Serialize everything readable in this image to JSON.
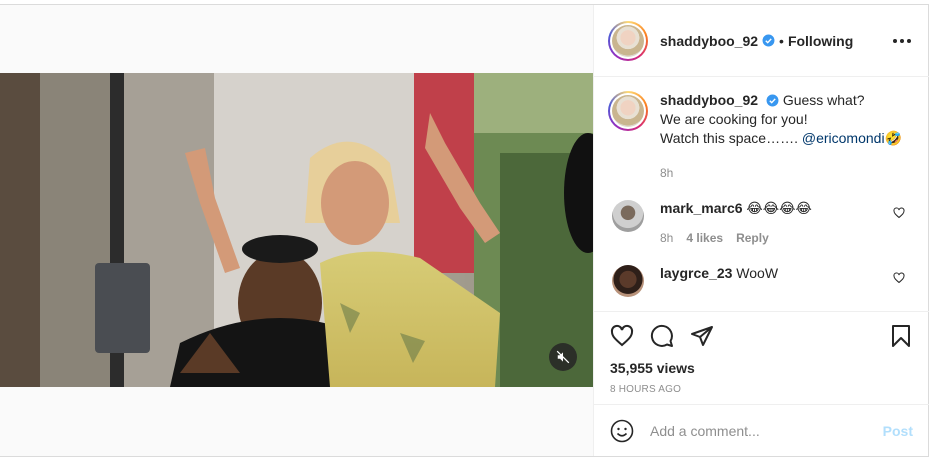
{
  "header": {
    "username": "shaddyboo_92",
    "separator": "•",
    "follow_status": "Following"
  },
  "caption": {
    "username": "shaddyboo_92",
    "line1": "Guess what?",
    "line2": "We are cooking for you!",
    "line3_prefix": "Watch this space…….",
    "mention": "@ericomondi",
    "line3_suffix": "🤣",
    "time": "8h"
  },
  "comments": [
    {
      "username": "mark_marc6",
      "text": "😂😂😂😂",
      "time": "8h",
      "likes": "4 likes",
      "reply": "Reply"
    },
    {
      "username": "laygrce_23",
      "text": "WooW"
    }
  ],
  "stats": {
    "views": "35,955 views",
    "ago": "8 HOURS AGO"
  },
  "composer": {
    "placeholder": "Add a comment...",
    "post_label": "Post"
  },
  "colors": {
    "verified": "#3897f0",
    "link": "#00376b",
    "post_disabled": "#b2dffc"
  }
}
